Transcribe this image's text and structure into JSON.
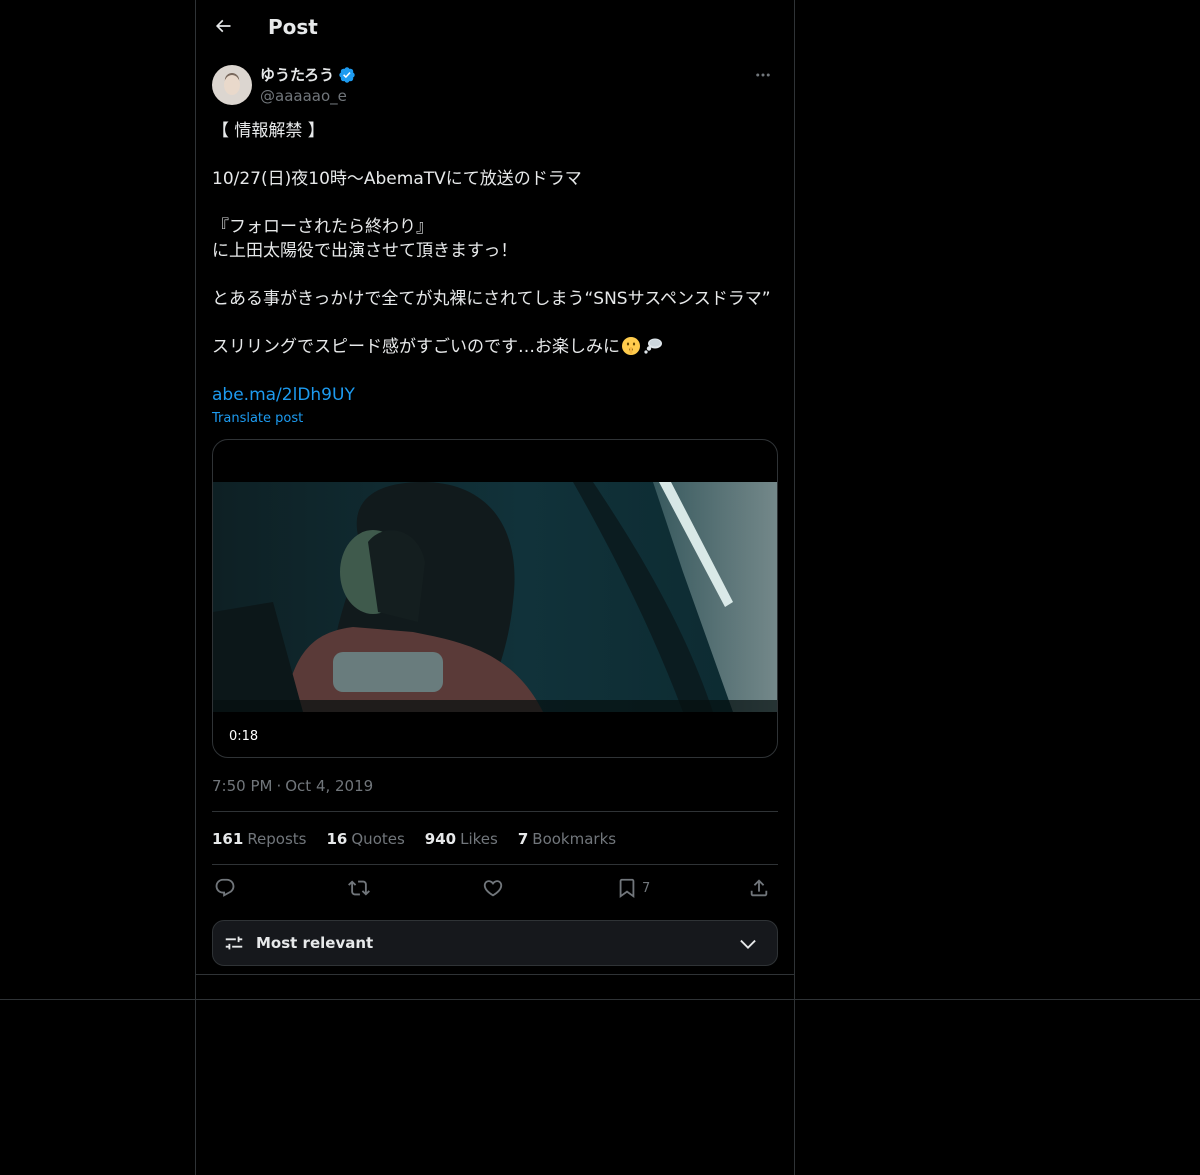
{
  "topbar": {
    "title": "Post"
  },
  "author": {
    "display_name": "ゆうたろう",
    "handle": "@aaaaao_e",
    "verified": true
  },
  "post": {
    "lines": [
      "【 情報解禁 】",
      "",
      "10/27(日)夜10時〜AbemaTVにて放送のドラマ",
      "",
      "『フォローされたら終わり』",
      "に上田太陽役で出演させて頂きますっ！",
      "",
      "とある事がきっかけで全てが丸裸にされてしまう“SNSサスペンスドラマ”",
      "",
      "スリリングでスピード感がすごいのです…お楽しみに"
    ],
    "emojis": [
      "shushing-face-icon",
      "thought-balloon-icon"
    ],
    "link": "abe.ma/2lDh9UY",
    "translate": "Translate post"
  },
  "media": {
    "duration": "0:18"
  },
  "meta": {
    "time": "7:50 PM",
    "separator": "·",
    "date": "Oct 4, 2019"
  },
  "stats": {
    "reposts_count": "161",
    "reposts_label": "Reposts",
    "quotes_count": "16",
    "quotes_label": "Quotes",
    "likes_count": "940",
    "likes_label": "Likes",
    "bookmarks_count": "7",
    "bookmarks_label": "Bookmarks"
  },
  "actions": {
    "bookmark_count": "7"
  },
  "sort": {
    "label": "Most relevant"
  },
  "colors": {
    "background": "#000000",
    "text": "#e7e9ea",
    "muted": "#71767b",
    "accent": "#1d9bf0",
    "border": "#2f3336"
  }
}
